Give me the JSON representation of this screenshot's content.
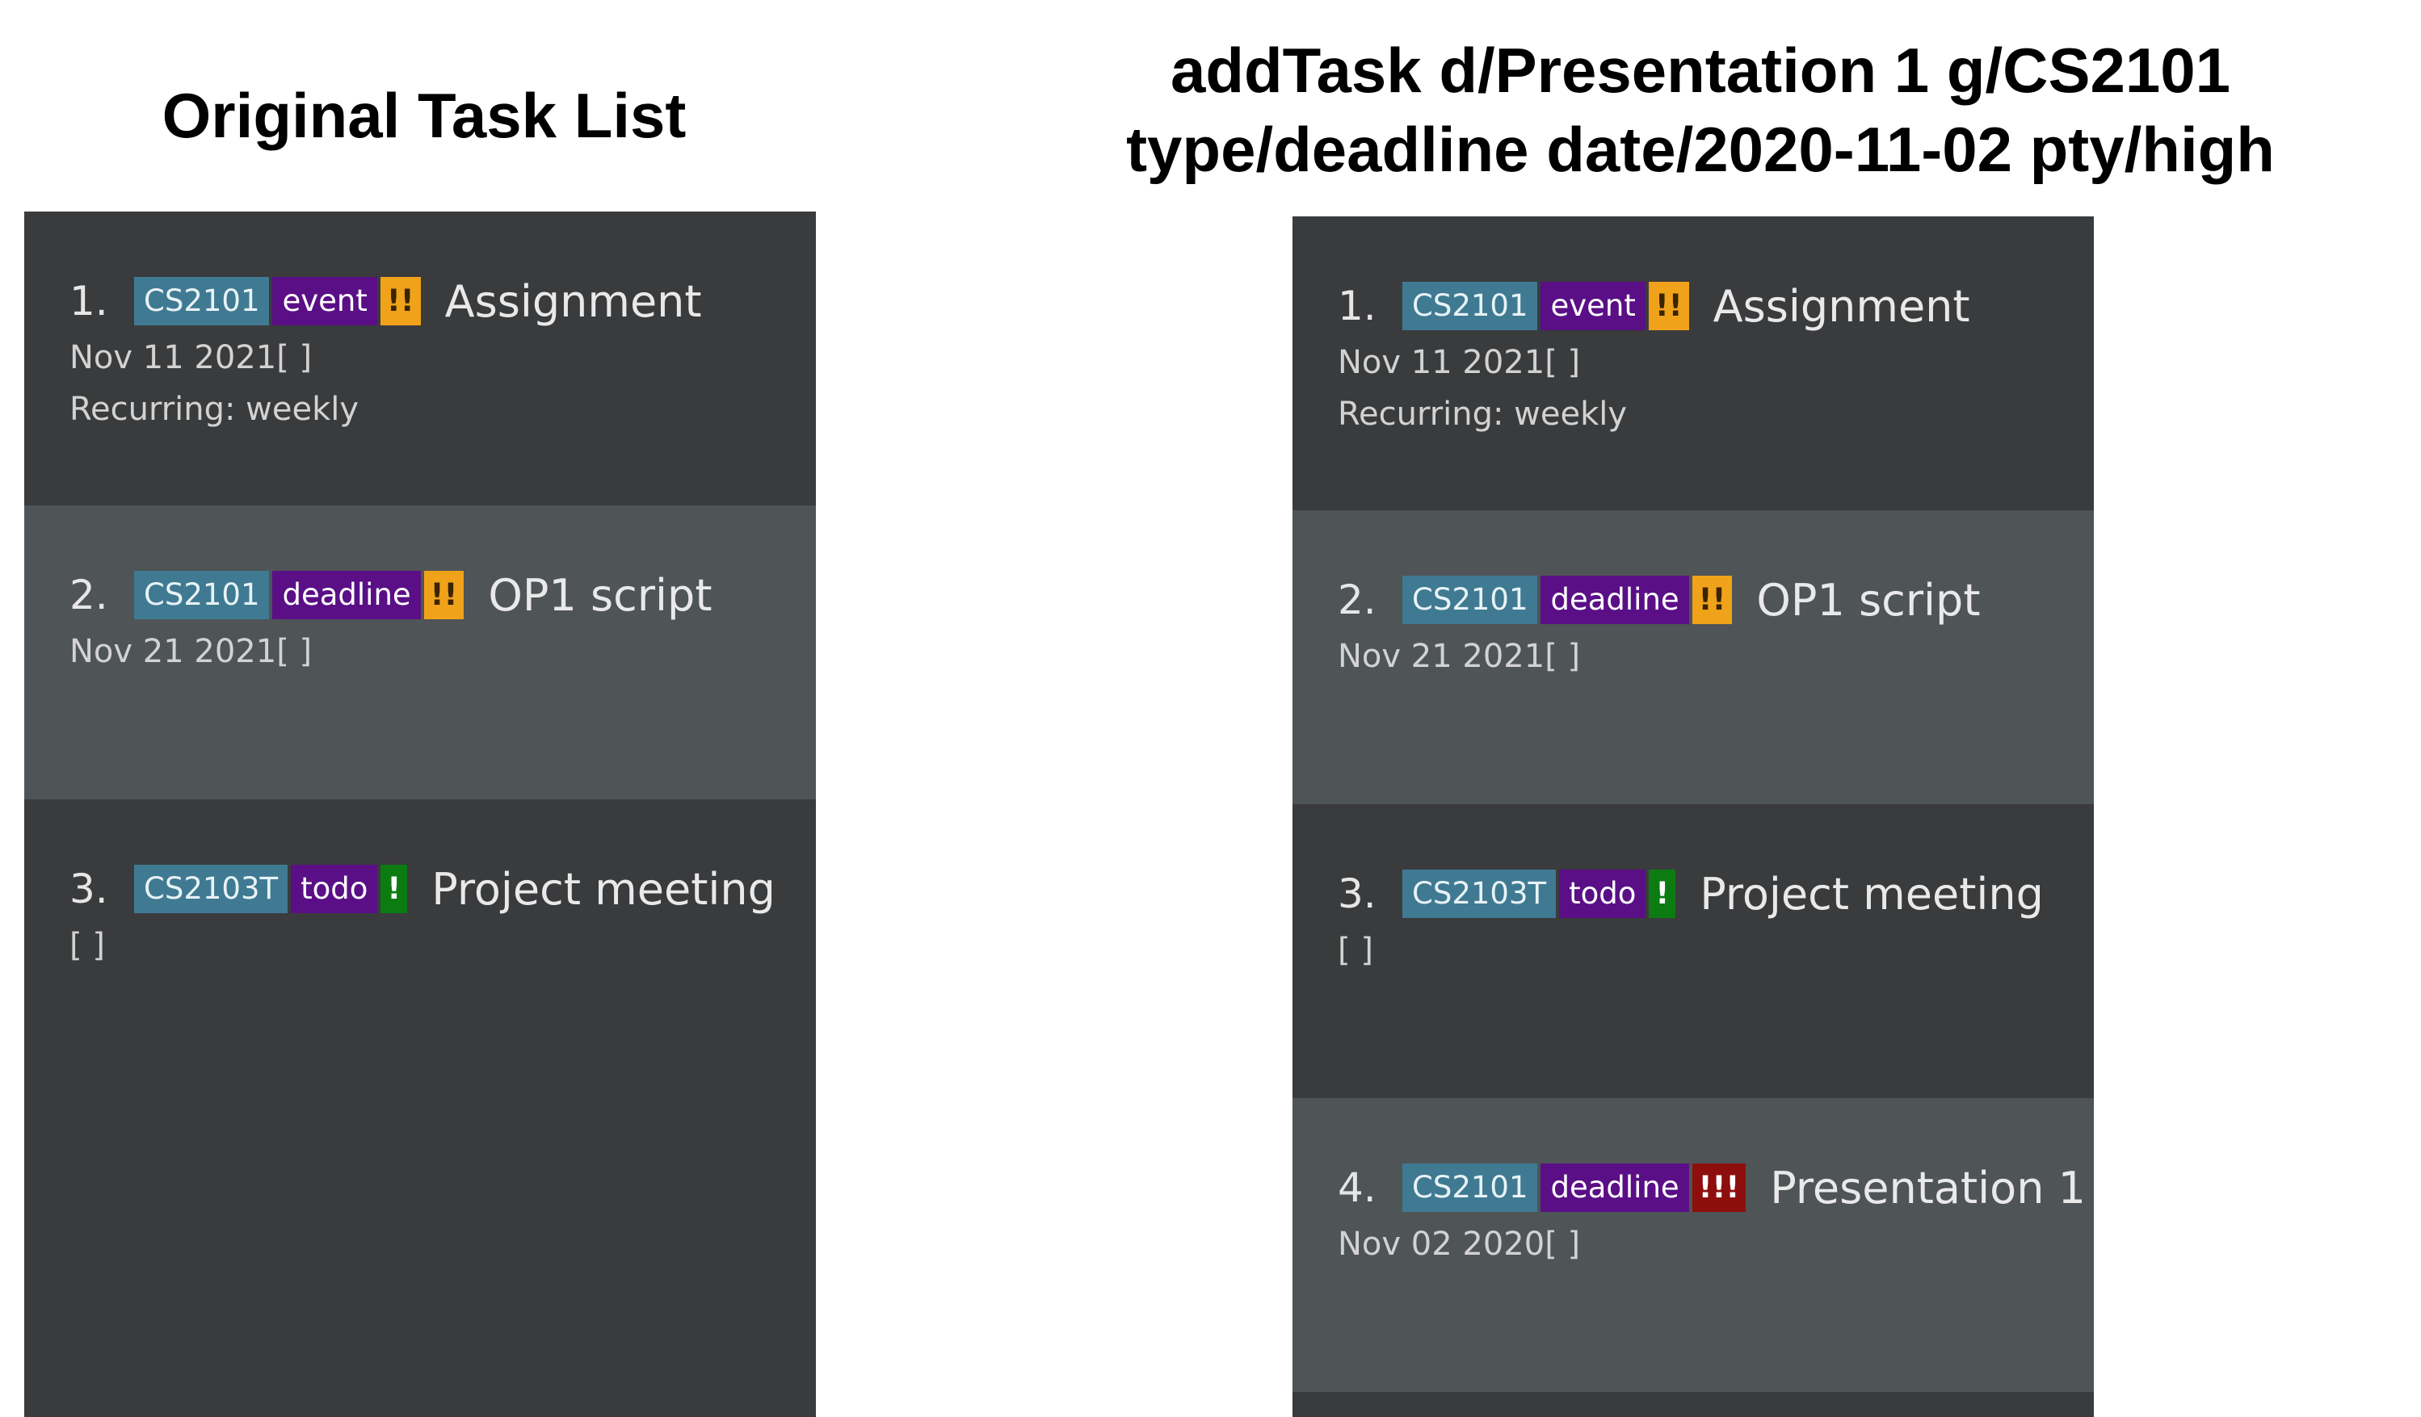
{
  "left": {
    "title": "Original Task List",
    "tasks": [
      {
        "index": "1.",
        "module": "CS2101",
        "type": "event",
        "priority": "!!",
        "priority_color": "#f0a21a",
        "name": "Assignment",
        "date": "Nov 11 2021[ ]",
        "recurring": "Recurring: weekly"
      },
      {
        "index": "2.",
        "module": "CS2101",
        "type": "deadline",
        "priority": "!!",
        "priority_color": "#f0a21a",
        "name": "OP1 script",
        "date": "Nov 21 2021[ ]"
      },
      {
        "index": "3.",
        "module": "CS2103T",
        "type": "todo",
        "priority": "!",
        "priority_color": "#0c7c12",
        "name": "Project meeting",
        "date": "[ ]"
      }
    ]
  },
  "right": {
    "title_line1": "addTask d/Presentation 1 g/CS2101",
    "title_line2": "type/deadline date/2020-11-02 pty/high",
    "tasks": [
      {
        "index": "1.",
        "module": "CS2101",
        "type": "event",
        "priority": "!!",
        "priority_color": "#f0a21a",
        "name": "Assignment",
        "date": "Nov 11 2021[ ]",
        "recurring": "Recurring: weekly"
      },
      {
        "index": "2.",
        "module": "CS2101",
        "type": "deadline",
        "priority": "!!",
        "priority_color": "#f0a21a",
        "name": "OP1 script",
        "date": "Nov 21 2021[ ]"
      },
      {
        "index": "3.",
        "module": "CS2103T",
        "type": "todo",
        "priority": "!",
        "priority_color": "#0c7c12",
        "name": "Project meeting",
        "date": "[ ]"
      },
      {
        "index": "4.",
        "module": "CS2101",
        "type": "deadline",
        "priority": "!!!",
        "priority_color": "#8e0e0e",
        "name": "Presentation 1",
        "date": "Nov 02 2020[ ]"
      }
    ]
  }
}
